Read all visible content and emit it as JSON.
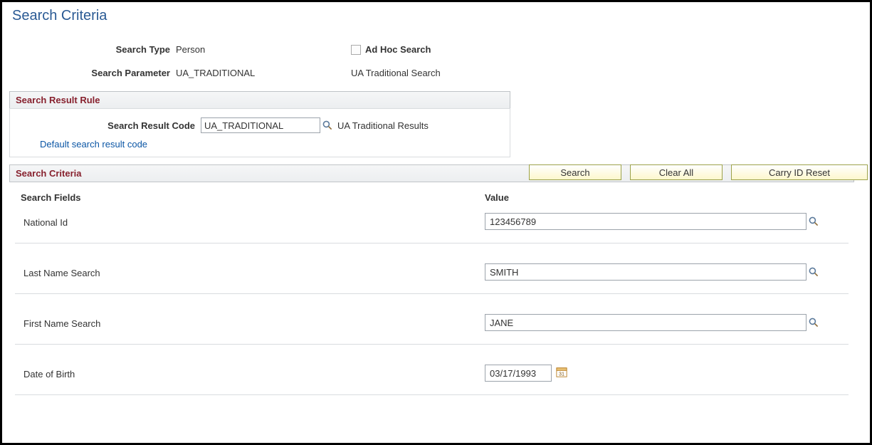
{
  "page_title": "Search Criteria",
  "top": {
    "search_type_label": "Search Type",
    "search_type_value": "Person",
    "adhoc_label": "Ad Hoc Search",
    "adhoc_checked": false,
    "search_parameter_label": "Search Parameter",
    "search_parameter_value": "UA_TRADITIONAL",
    "search_parameter_desc": "UA Traditional Search"
  },
  "result_rule": {
    "section_title": "Search Result Rule",
    "code_label": "Search Result Code",
    "code_value": "UA_TRADITIONAL",
    "code_desc": "UA Traditional Results",
    "default_link": "Default search result code"
  },
  "buttons": {
    "search": "Search",
    "clear_all": "Clear All",
    "carry_id_reset": "Carry ID Reset"
  },
  "criteria": {
    "section_title": "Search Criteria",
    "col_fields": "Search Fields",
    "col_value": "Value",
    "rows": [
      {
        "label": "National Id",
        "value": "123456789",
        "lookup": true,
        "calendar": false
      },
      {
        "label": "Last Name Search",
        "value": "SMITH",
        "lookup": true,
        "calendar": false
      },
      {
        "label": "First Name Search",
        "value": "JANE",
        "lookup": true,
        "calendar": false
      },
      {
        "label": "Date of Birth",
        "value": "03/17/1993",
        "lookup": false,
        "calendar": true
      }
    ]
  }
}
